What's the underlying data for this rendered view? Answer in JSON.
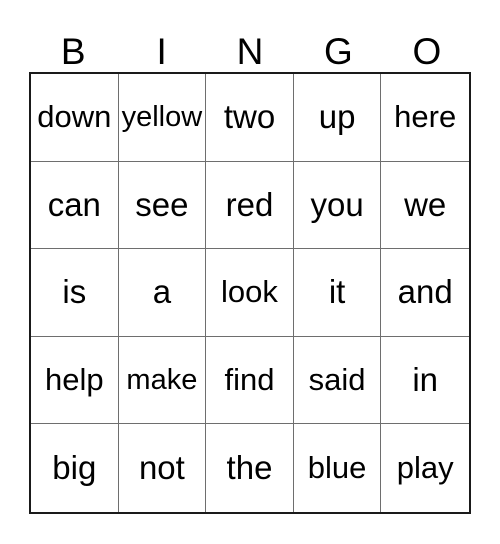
{
  "card": {
    "title": "BINGO",
    "columns": [
      "B",
      "I",
      "N",
      "G",
      "O"
    ],
    "grid_size": "5x5",
    "colors": {
      "background": "#ffffff",
      "text": "#000000",
      "outer_border": "#1a1a1a",
      "grid_line": "#6e6e6e"
    },
    "rows": [
      {
        "cells": [
          {
            "word": "down",
            "size": "md"
          },
          {
            "word": "yellow",
            "size": "sm"
          },
          {
            "word": "two",
            "size": "lg"
          },
          {
            "word": "up",
            "size": "lg"
          },
          {
            "word": "here",
            "size": "md"
          }
        ]
      },
      {
        "cells": [
          {
            "word": "can",
            "size": "lg"
          },
          {
            "word": "see",
            "size": "lg"
          },
          {
            "word": "red",
            "size": "lg"
          },
          {
            "word": "you",
            "size": "lg"
          },
          {
            "word": "we",
            "size": "lg"
          }
        ]
      },
      {
        "cells": [
          {
            "word": "is",
            "size": "lg"
          },
          {
            "word": "a",
            "size": "lg"
          },
          {
            "word": "look",
            "size": "md"
          },
          {
            "word": "it",
            "size": "lg"
          },
          {
            "word": "and",
            "size": "lg"
          }
        ]
      },
      {
        "cells": [
          {
            "word": "help",
            "size": "md"
          },
          {
            "word": "make",
            "size": "sm"
          },
          {
            "word": "find",
            "size": "md"
          },
          {
            "word": "said",
            "size": "md"
          },
          {
            "word": "in",
            "size": "lg"
          }
        ]
      },
      {
        "cells": [
          {
            "word": "big",
            "size": "lg"
          },
          {
            "word": "not",
            "size": "lg"
          },
          {
            "word": "the",
            "size": "lg"
          },
          {
            "word": "blue",
            "size": "md"
          },
          {
            "word": "play",
            "size": "md"
          }
        ]
      }
    ]
  }
}
